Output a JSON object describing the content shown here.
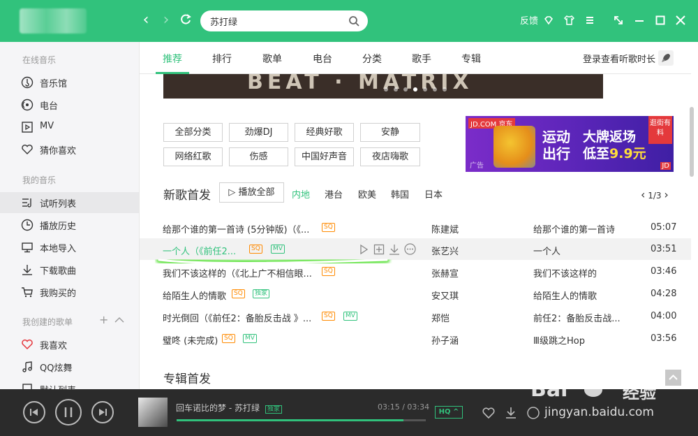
{
  "topbar": {
    "search_value": "苏打绿",
    "feedback": "反馈"
  },
  "sidebar": {
    "section_online": "在线音乐",
    "online_items": [
      {
        "label": "音乐馆"
      },
      {
        "label": "电台"
      },
      {
        "label": "MV"
      },
      {
        "label": "猜你喜欢"
      }
    ],
    "section_mine": "我的音乐",
    "mine_items": [
      {
        "label": "试听列表"
      },
      {
        "label": "播放历史"
      },
      {
        "label": "本地导入"
      },
      {
        "label": "下载歌曲"
      },
      {
        "label": "我购买的"
      }
    ],
    "section_created": "我创建的歌单",
    "created_items": [
      {
        "label": "我喜欢"
      },
      {
        "label": "QQ炫舞"
      },
      {
        "label": "默认列表"
      }
    ]
  },
  "tabs": [
    "推荐",
    "排行",
    "歌单",
    "电台",
    "分类",
    "歌手",
    "专辑"
  ],
  "login_link": "登录查看听歌时长",
  "categories": [
    "全部分类",
    "劲爆DJ",
    "经典好歌",
    "安静",
    "网络红歌",
    "伤感",
    "中国好声音",
    "夜店嗨歌"
  ],
  "ad": {
    "brand": "JD.COM 京东",
    "line1a": "运动",
    "line1b": "大牌返场",
    "line2a": "出行",
    "line2b": "低至",
    "price": "9.9元",
    "tag": "逛街有料",
    "small": "广告",
    "corner": "JD"
  },
  "new_songs": {
    "title": "新歌首发",
    "play_all": "▷ 播放全部",
    "filters": [
      "内地",
      "港台",
      "欧美",
      "韩国",
      "日本"
    ],
    "page": "1/3",
    "rows": [
      {
        "title": "给那个谁的第一首诗 (5分钟版)（《...",
        "badges": [
          "SQ"
        ],
        "artist": "陈建斌",
        "album": "给那个谁的第一首诗",
        "duration": "05:07"
      },
      {
        "title": "一个人（《前任2...",
        "badges": [
          "SQ",
          "MV"
        ],
        "artist": "张艺兴",
        "album": "一个人",
        "duration": "03:51"
      },
      {
        "title": "我们不该这样的（《北上广不相信眼...",
        "badges": [
          "SQ"
        ],
        "artist": "张赫宣",
        "album": "我们不该这样的",
        "duration": "03:46"
      },
      {
        "title": "给陌生人的情歌",
        "badges": [
          "SQ",
          "独家"
        ],
        "artist": "安又琪",
        "album": "给陌生人的情歌",
        "duration": "04:28"
      },
      {
        "title": "时光倒回（《前任2：备胎反击战 》...",
        "badges": [
          "SQ",
          "MV"
        ],
        "artist": "郑恺",
        "album": "前任2：备胎反击战...",
        "duration": "04:00"
      },
      {
        "title": "璧咚 (未完成)",
        "badges": [
          "SQ",
          "MV"
        ],
        "artist": "孙子涵",
        "album": "Ⅲ级跳之Hop",
        "duration": "03:56"
      }
    ]
  },
  "album_section": {
    "title": "专辑首发"
  },
  "player": {
    "song": "回车诺比的梦",
    "separator": " - ",
    "artist": "苏打绿",
    "tag": "独家",
    "time": "03:15 / 03:34",
    "progress": 0.91,
    "quality": "HQ"
  },
  "watermark": {
    "brand": "Bai",
    "brand2": "经验",
    "url": "jingyan.baidu.com"
  },
  "colors": {
    "accent": "#31c27c",
    "sq_badge": "#ff8a00",
    "player_bg": "#2b2b2b"
  }
}
